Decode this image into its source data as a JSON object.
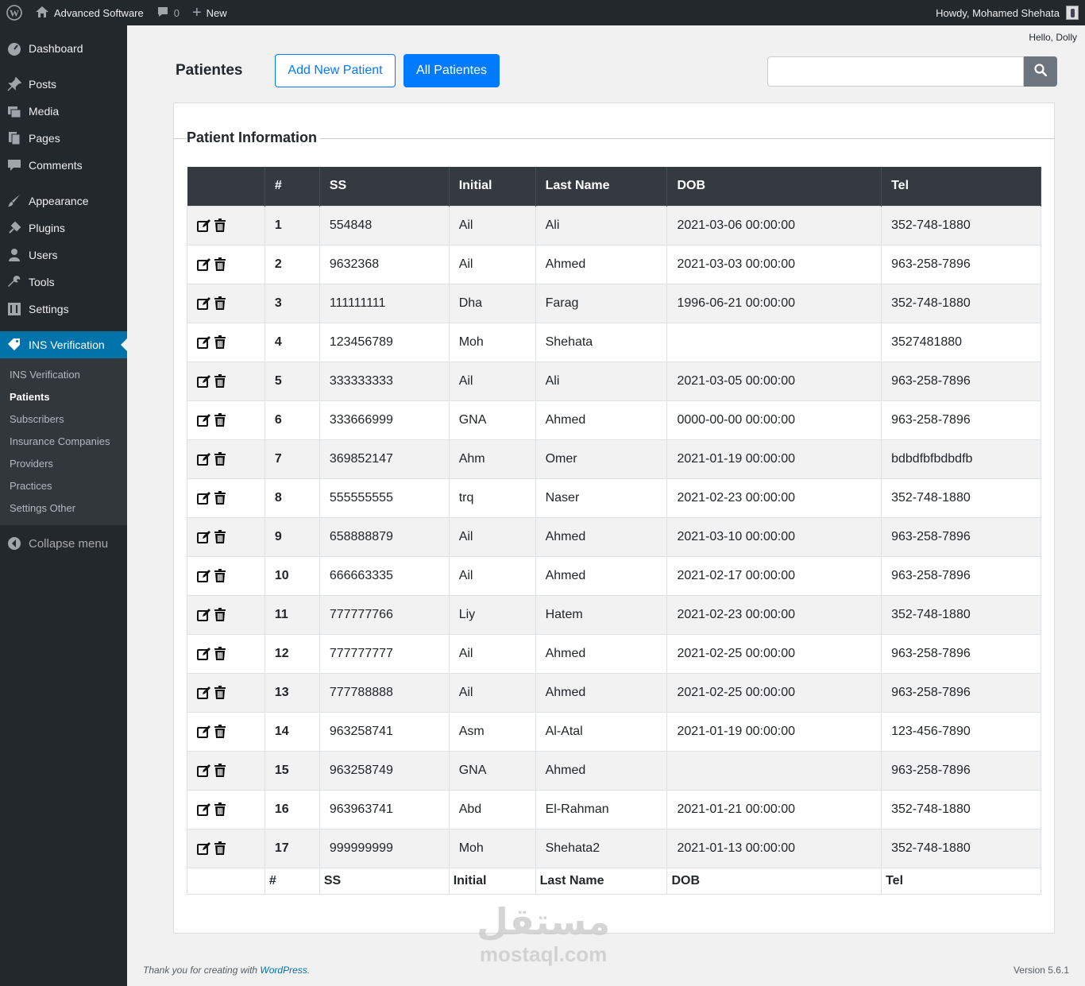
{
  "adminbar": {
    "site_name": "Advanced Software",
    "comments_count": "0",
    "new_label": "New",
    "howdy": "Howdy, Mohamed Shehata"
  },
  "sidebar": {
    "items": [
      {
        "label": "Dashboard",
        "icon": "dashboard-icon"
      },
      {
        "label": "Posts",
        "icon": "pin-icon"
      },
      {
        "label": "Media",
        "icon": "media-icon"
      },
      {
        "label": "Pages",
        "icon": "pages-icon"
      },
      {
        "label": "Comments",
        "icon": "comment-icon"
      },
      {
        "label": "Appearance",
        "icon": "brush-icon"
      },
      {
        "label": "Plugins",
        "icon": "plugin-icon"
      },
      {
        "label": "Users",
        "icon": "user-icon"
      },
      {
        "label": "Tools",
        "icon": "wrench-icon"
      },
      {
        "label": "Settings",
        "icon": "settings-icon"
      },
      {
        "label": "INS Verification",
        "icon": "tag-icon"
      }
    ],
    "submenu": [
      "INS Verification",
      "Patients",
      "Subscribers",
      "Insurance Companies",
      "Providers",
      "Practices",
      "Settings Other"
    ],
    "collapse": "Collapse menu"
  },
  "header": {
    "hello": "Hello, Dolly",
    "title": "Patientes",
    "add_button": "Add New Patient",
    "all_button": "All Patientes",
    "search_placeholder": ""
  },
  "card": {
    "legend": "Patient Information"
  },
  "table": {
    "columns": [
      "",
      "#",
      "SS",
      "Initial",
      "Last Name",
      "DOB",
      "Tel"
    ],
    "footer_columns": [
      "",
      "#",
      "SS",
      "Initial",
      "Last Name",
      "DOB",
      "Tel"
    ],
    "rows": [
      [
        "1",
        "554848",
        "Ail",
        "Ali",
        "2021-03-06 00:00:00",
        "352-748-1880"
      ],
      [
        "2",
        "9632368",
        "Ail",
        "Ahmed",
        "2021-03-03 00:00:00",
        "963-258-7896"
      ],
      [
        "3",
        "111111111",
        "Dha",
        "Farag",
        "1996-06-21 00:00:00",
        "352-748-1880"
      ],
      [
        "4",
        "123456789",
        "Moh",
        "Shehata",
        "",
        "3527481880"
      ],
      [
        "5",
        "333333333",
        "Ail",
        "Ali",
        "2021-03-05 00:00:00",
        "963-258-7896"
      ],
      [
        "6",
        "333666999",
        "GNA",
        "Ahmed",
        "0000-00-00 00:00:00",
        "963-258-7896"
      ],
      [
        "7",
        "369852147",
        "Ahm",
        "Omer",
        "2021-01-19 00:00:00",
        "bdbdfbfbdbdfb"
      ],
      [
        "8",
        "555555555",
        "trq",
        "Naser",
        "2021-02-23 00:00:00",
        "352-748-1880"
      ],
      [
        "9",
        "658888879",
        "Ail",
        "Ahmed",
        "2021-03-10 00:00:00",
        "963-258-7896"
      ],
      [
        "10",
        "666663335",
        "Ail",
        "Ahmed",
        "2021-02-17 00:00:00",
        "963-258-7896"
      ],
      [
        "11",
        "777777766",
        "Liy",
        "Hatem",
        "2021-02-23 00:00:00",
        "352-748-1880"
      ],
      [
        "12",
        "777777777",
        "Ail",
        "Ahmed",
        "2021-02-25 00:00:00",
        "963-258-7896"
      ],
      [
        "13",
        "777788888",
        "Ail",
        "Ahmed",
        "2021-02-25 00:00:00",
        "963-258-7896"
      ],
      [
        "14",
        "963258741",
        "Asm",
        "Al-Atal",
        "2021-01-19 00:00:00",
        "123-456-7890"
      ],
      [
        "15",
        "963258749",
        "GNA",
        "Ahmed",
        "",
        "963-258-7896"
      ],
      [
        "16",
        "963963741",
        "Abd",
        "El-Rahman",
        "2021-01-21 00:00:00",
        "352-748-1880"
      ],
      [
        "17",
        "999999999",
        "Moh",
        "Shehata2",
        "2021-01-13 00:00:00",
        "352-748-1880"
      ]
    ]
  },
  "footer": {
    "thanks_prefix": "Thank you for creating with ",
    "thanks_link": "WordPress",
    "thanks_suffix": ".",
    "version": "Version 5.6.1"
  },
  "watermark": {
    "arabic": "مستقل",
    "latin": "mostaql.com"
  },
  "colors": {
    "primary": "#007bff",
    "wp_blue": "#0073aa",
    "dark": "#23282d",
    "table_head": "#343a40"
  }
}
